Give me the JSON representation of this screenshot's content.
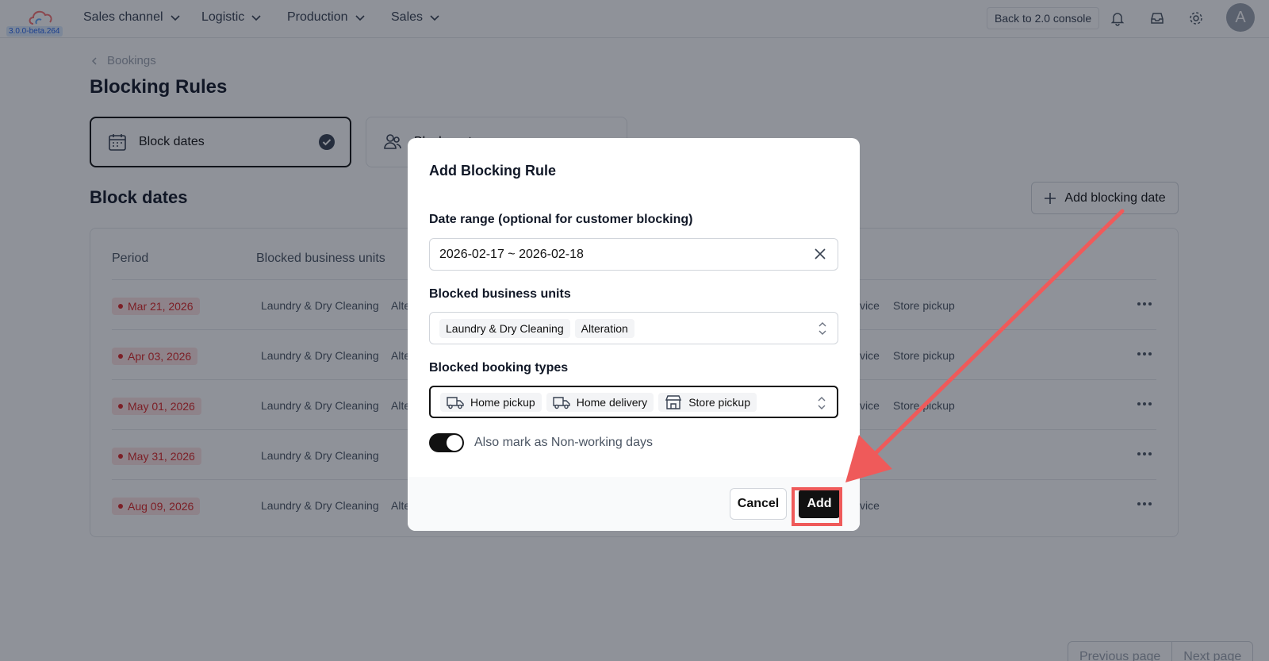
{
  "app": {
    "version": "3.0.0-beta.264",
    "menu": [
      "Sales channel",
      "Logistic",
      "Production",
      "Sales"
    ],
    "back_console_label": "Back to 2.0 console",
    "avatar_initial": "A"
  },
  "page": {
    "breadcrumb": "Bookings",
    "title": "Blocking Rules",
    "tabs": [
      {
        "label": "Block dates",
        "selected": true
      },
      {
        "label": "Block customers",
        "selected": false
      }
    ],
    "section_title": "Block dates",
    "add_date_label": "Add blocking date",
    "table": {
      "headers": [
        "Period",
        "Blocked business units"
      ],
      "rows": [
        {
          "date": "Mar 21, 2026",
          "unit1": "Laundry & Dry Cleaning",
          "unit2": "Alte",
          "type_a": "vice",
          "type_b": "Store pickup"
        },
        {
          "date": "Apr 03, 2026",
          "unit1": "Laundry & Dry Cleaning",
          "unit2": "Alte",
          "type_a": "vice",
          "type_b": "Store pickup"
        },
        {
          "date": "May 01, 2026",
          "unit1": "Laundry & Dry Cleaning",
          "unit2": "Alte",
          "type_a": "vice",
          "type_b": "Store pickup"
        },
        {
          "date": "May 31, 2026",
          "unit1": "Laundry & Dry Cleaning",
          "unit2": "",
          "type_a": "",
          "type_b": ""
        },
        {
          "date": "Aug 09, 2026",
          "unit1": "Laundry & Dry Cleaning",
          "unit2": "Alte",
          "type_a": "vice",
          "type_b": ""
        }
      ]
    },
    "pagination": {
      "prev": "Previous page",
      "next": "Next page"
    }
  },
  "modal": {
    "title": "Add Blocking Rule",
    "date_range": {
      "label": "Date range (optional for customer blocking)",
      "value": "2026-02-17 ~ 2026-02-18"
    },
    "business_units": {
      "label": "Blocked business units",
      "selected": [
        "Laundry & Dry Cleaning",
        "Alteration"
      ]
    },
    "booking_types": {
      "label": "Blocked booking types",
      "selected": [
        "Home pickup",
        "Home delivery",
        "Store pickup"
      ]
    },
    "non_working_toggle": {
      "label": "Also mark as Non-working days",
      "on": true
    },
    "cancel_label": "Cancel",
    "add_label": "Add"
  },
  "icons": {
    "nav": [
      "bell-icon",
      "inbox-icon",
      "gear-icon"
    ],
    "tabs": [
      "calendar-icon",
      "users-icon"
    ],
    "booking_types": [
      "truck-icon",
      "truck-icon",
      "store-icon"
    ]
  },
  "colors": {
    "accent": "#111111",
    "date_badge_bg": "#fee2e2",
    "date_badge_text": "#dc2626",
    "annotation": "#ef5a5a"
  }
}
